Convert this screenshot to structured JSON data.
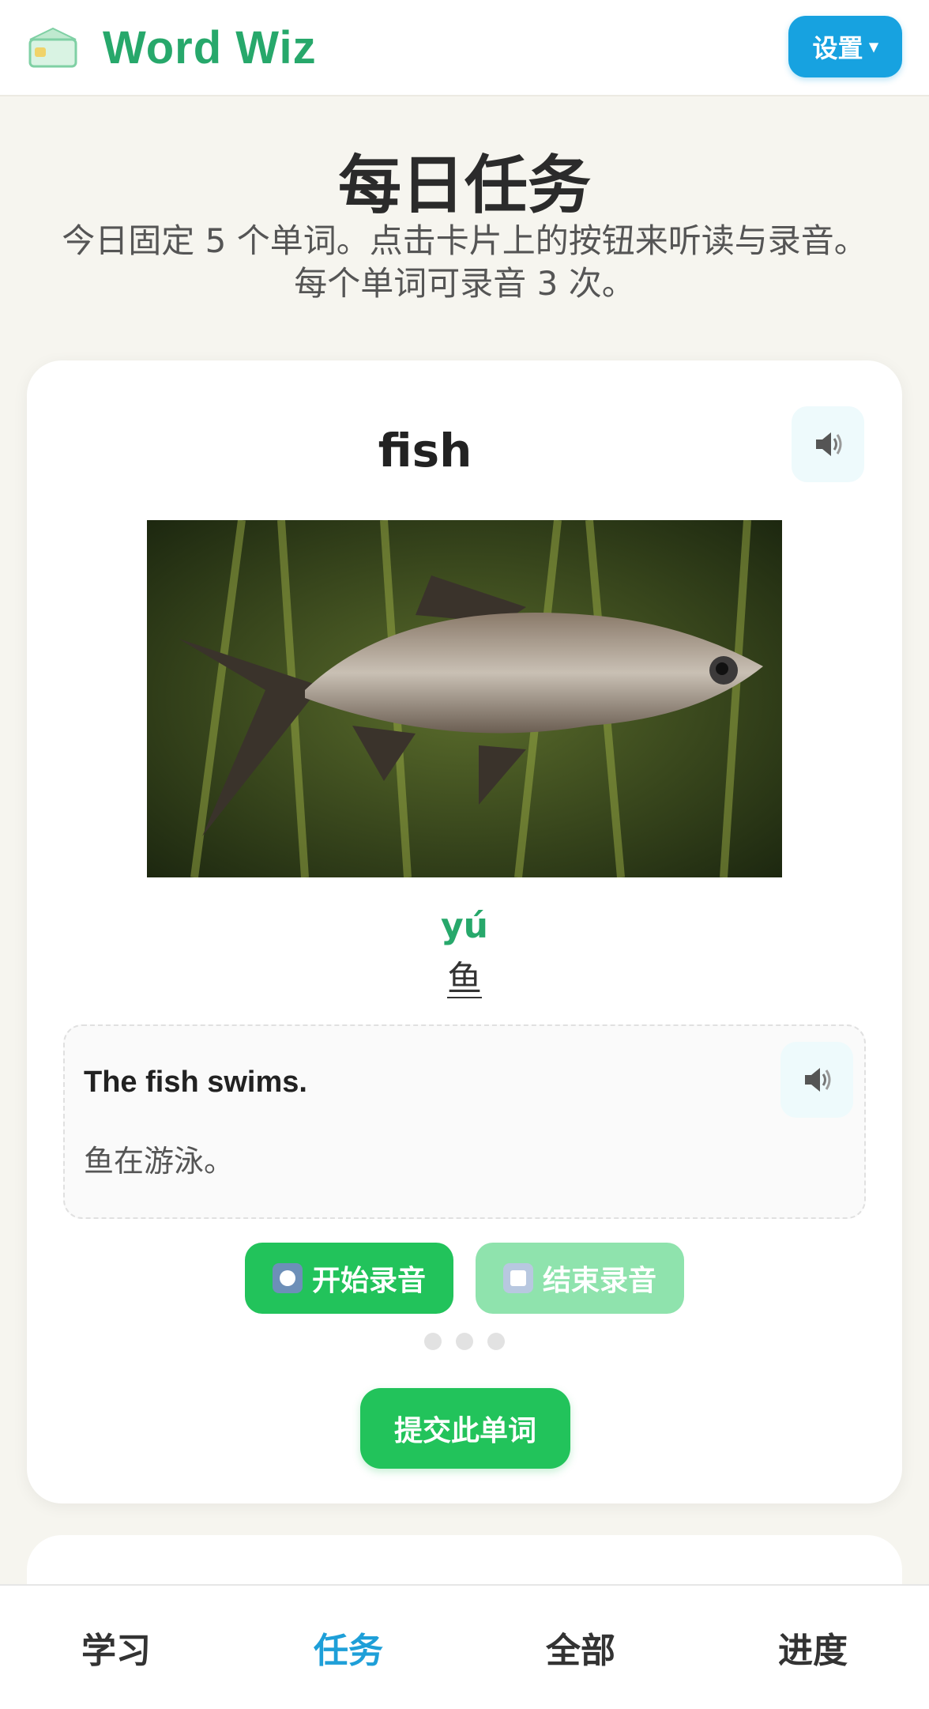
{
  "header": {
    "brand": "Word Wiz",
    "logo_icon": "card-icon",
    "settings_label": "设置",
    "settings_caret": "▾"
  },
  "page": {
    "title": "每日任务",
    "subtitle_line1": "今日固定 5 个单词。点击卡片上的按钮来听读与录音。",
    "subtitle_line2": "每个单词可录音 3 次。"
  },
  "card": {
    "word": "fish",
    "pinyin": "yú",
    "hanzi": "鱼",
    "sentence_en": "The fish swims.",
    "sentence_zh": "鱼在游泳。",
    "record_start_label": "开始录音",
    "record_stop_label": "结束录音",
    "attempts_total": 3,
    "attempts_used": 0,
    "submit_label": "提交此单词"
  },
  "nav": {
    "items": [
      {
        "label": "学习",
        "active": false
      },
      {
        "label": "任务",
        "active": true
      },
      {
        "label": "全部",
        "active": false
      },
      {
        "label": "进度",
        "active": false
      }
    ]
  },
  "colors": {
    "brand_green": "#27a86b",
    "accent_blue": "#17a2e0",
    "record_green": "#22c35b",
    "nav_active": "#1e9fd8"
  }
}
